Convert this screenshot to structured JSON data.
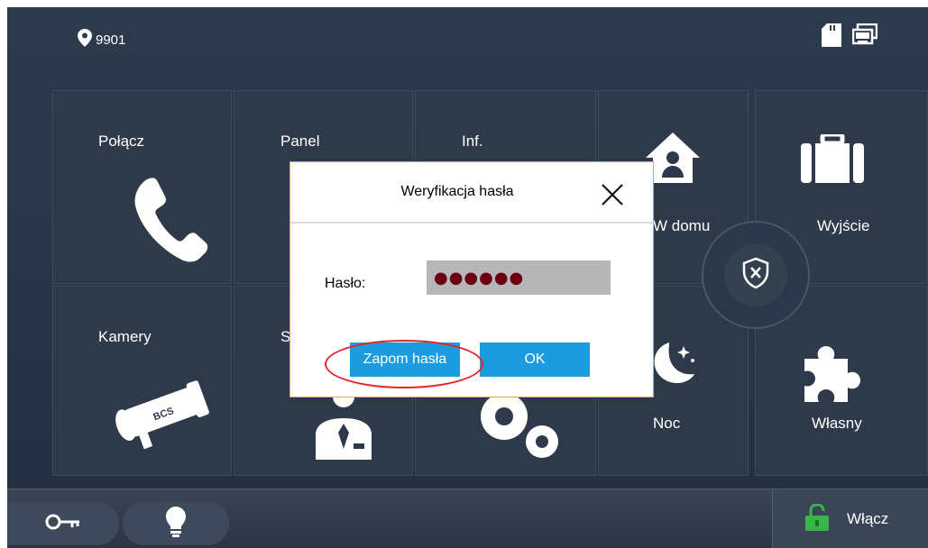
{
  "status_bar": {
    "location_number": "9901",
    "icons": [
      "location-pin-icon",
      "sd-card-icon",
      "monitor-icon"
    ]
  },
  "tiles": {
    "call_label": "Połącz",
    "panel_label": "Panel",
    "info_label": "Inf.",
    "cameras_label": "Kamery",
    "s_label": "S",
    "home_label": "W domu",
    "exit_label": "Wyjście",
    "night_label": "Noc",
    "custom_label": "Własny"
  },
  "dialog": {
    "title": "Weryfikacja hasła",
    "password_label": "Hasło:",
    "password_value": "●●●●●●",
    "forgot_button": "Zapom hasła",
    "ok_button": "OK"
  },
  "bottom_bar": {
    "enable_label": "Włącz"
  },
  "colors": {
    "accent_blue": "#1c9be0",
    "highlight_red": "#e0262c",
    "dialog_border": "#e3a54a",
    "unlock_green": "#39b54a"
  }
}
